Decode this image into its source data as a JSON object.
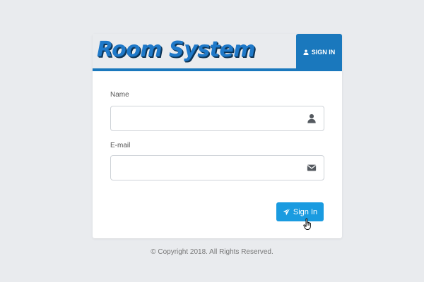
{
  "app": {
    "logo_text": "Room System"
  },
  "header": {
    "tab_label": "SIGN IN",
    "tab_icon": "user-icon"
  },
  "form": {
    "name_label": "Name",
    "name_value": "",
    "name_placeholder": "",
    "name_icon": "user-icon",
    "email_label": "E-mail",
    "email_value": "",
    "email_placeholder": "",
    "email_icon": "envelope-icon",
    "submit_label": "Sign In",
    "submit_icon": "paper-plane-icon"
  },
  "footer": {
    "copyright": "© Copyright 2018. All Rights Reserved."
  },
  "colors": {
    "background": "#e9ebee",
    "accent": "#1a78bd",
    "button": "#1a9be0",
    "logo": "#1f79c9"
  }
}
